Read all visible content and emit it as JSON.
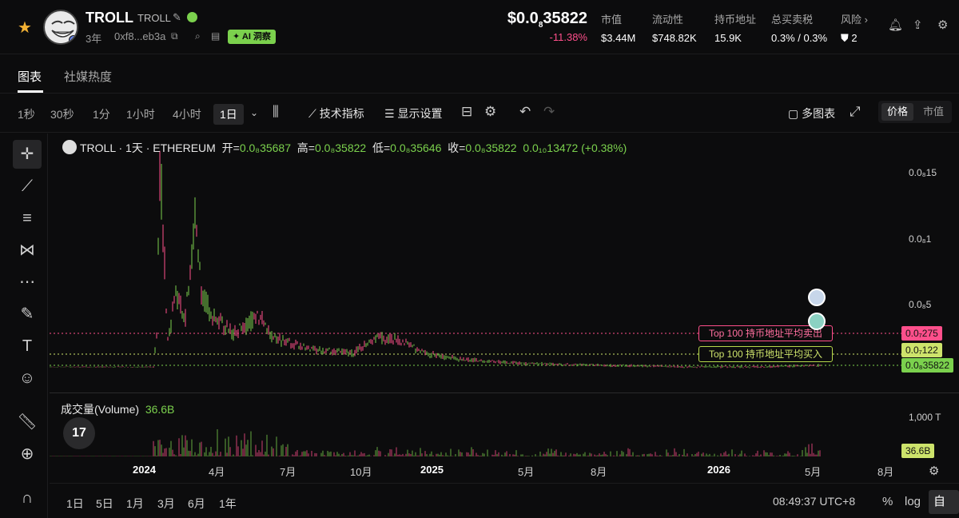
{
  "header": {
    "token_symbol": "TROLL",
    "token_name": "TROLL",
    "age": "3年",
    "address": "0xf8...eb3a",
    "ai_badge": "AI 洞察",
    "price_prefix": "$0.0",
    "price_sub": "8",
    "price_rest": "35822",
    "change": "-11.38%",
    "stats": [
      {
        "label": "市值",
        "value": "$3.44M"
      },
      {
        "label": "流动性",
        "value": "$748.82K"
      },
      {
        "label": "持币地址",
        "value": "15.9K"
      },
      {
        "label": "总买卖税",
        "value": "0.3% / 0.3%"
      },
      {
        "label": "风险 ›",
        "value": "2"
      }
    ]
  },
  "tabs": [
    "图表",
    "社媒热度"
  ],
  "toolbar": {
    "intervals": [
      "1秒",
      "30秒",
      "1分",
      "1小时",
      "4小时",
      "1日"
    ],
    "active_interval": "1日",
    "indicators": "技术指标",
    "display": "显示设置",
    "multi_chart": "多图表",
    "price_toggle": [
      "价格",
      "市值"
    ]
  },
  "legend": {
    "title": "TROLL · 1天 · ETHEREUM",
    "open_label": "开=",
    "open_val": "0.0₈35687",
    "high_label": "高=",
    "high_val": "0.0₈35822",
    "low_label": "低=",
    "low_val": "0.0₈35646",
    "close_label": "收=",
    "close_val": "0.0₈35822",
    "delta": "0.0₁₀13472 (+0.38%)"
  },
  "volume": {
    "label": "成交量(Volume)",
    "value": "36.6B",
    "tag": "36.6B",
    "axis": "1,000 T"
  },
  "y_axis": {
    "ticks": [
      "0.0₈15",
      "0.0₈1",
      "0.0₈5"
    ],
    "sell_tag": "0.0₇275",
    "buy_tag": "0.0₇122",
    "current_tag": "0.0₈35822"
  },
  "annotations": {
    "sell": "Top 100 持币地址平均卖出",
    "buy": "Top 100 持币地址平均买入"
  },
  "x_axis": [
    "2024",
    "4月",
    "7月",
    "10月",
    "2025",
    "5月",
    "8月",
    "2026",
    "5月",
    "8月"
  ],
  "bottom": {
    "ranges": [
      "1日",
      "5日",
      "1月",
      "3月",
      "6月",
      "1年"
    ],
    "clock": "08:49:37 UTC+8",
    "percent": "%",
    "log": "log",
    "auto": "自动"
  },
  "colors": {
    "up": "#7bd14d",
    "down": "#ff4f8b",
    "accent": "#f2b134"
  }
}
